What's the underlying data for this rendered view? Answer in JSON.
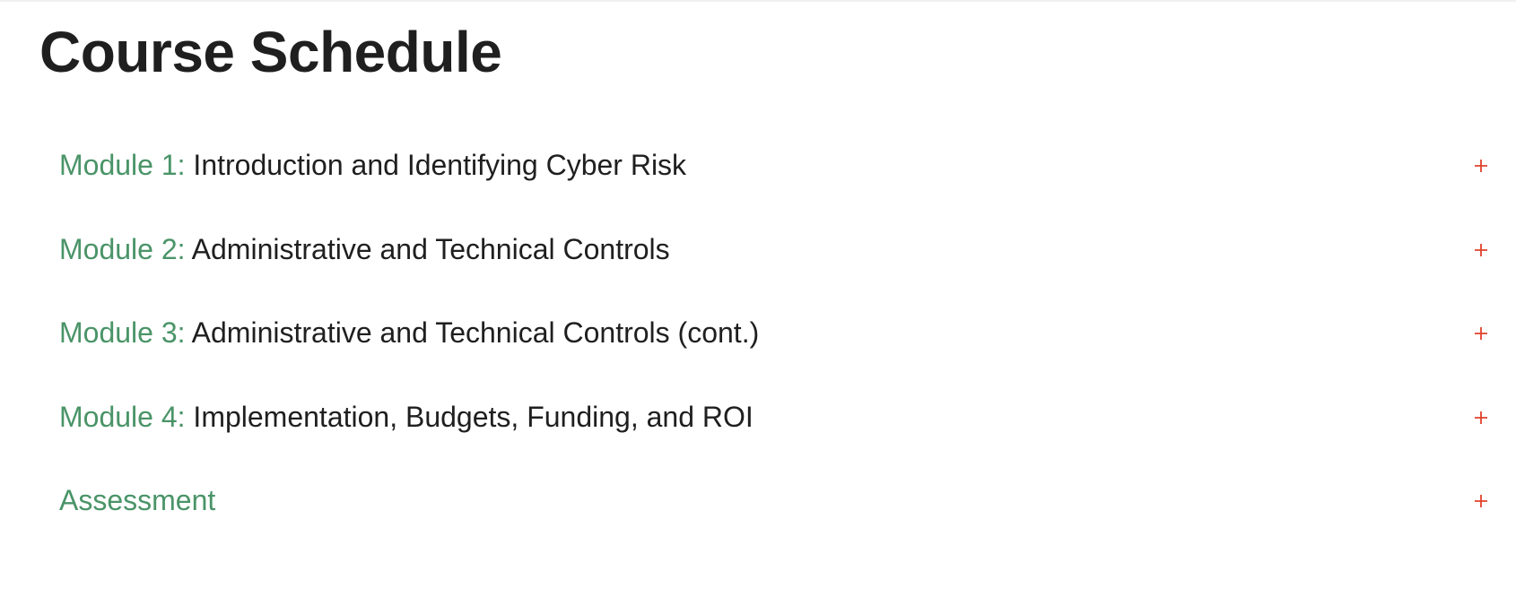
{
  "page": {
    "title": "Course Schedule"
  },
  "schedule": {
    "items": [
      {
        "prefix": "Module 1:",
        "title": "Introduction and Identifying Cyber Risk",
        "icon": "plus-icon"
      },
      {
        "prefix": "Module 2:",
        "title": "Administrative and Technical Controls",
        "icon": "plus-icon"
      },
      {
        "prefix": "Module 3:",
        "title": "Administrative and Technical Controls (cont.)",
        "icon": "plus-icon"
      },
      {
        "prefix": "Module 4:",
        "title": "Implementation, Budgets, Funding, and ROI",
        "icon": "plus-icon"
      },
      {
        "prefix": "Assessment",
        "title": "",
        "icon": "plus-icon"
      }
    ]
  },
  "colors": {
    "prefix": "#4a9468",
    "title": "#1f1f1f",
    "icon": "#e0422b",
    "background": "#ffffff"
  }
}
